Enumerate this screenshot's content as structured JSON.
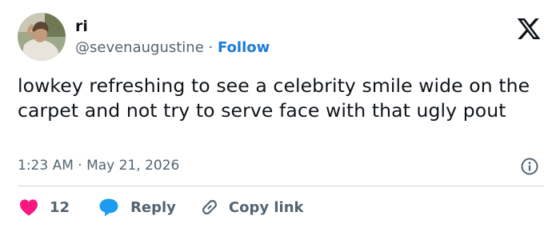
{
  "author": {
    "name": "ri",
    "handle": "@sevenaugustine",
    "separator": "·",
    "follow_label": "Follow"
  },
  "tweet": {
    "text": "lowkey refreshing to see a celebrity smile wide on the carpet and not try to serve face with that ugly pout",
    "timestamp": "1:23 AM · May 21, 2026"
  },
  "actions": {
    "like_count": "12",
    "reply_label": "Reply",
    "copy_link_label": "Copy link"
  },
  "icons": {
    "logo": "x-logo-icon",
    "info": "info-icon",
    "like": "heart-icon",
    "reply": "speech-bubble-icon",
    "copy": "link-icon"
  },
  "colors": {
    "link_blue": "#1d7bd8",
    "like_red": "#f91880",
    "reply_blue": "#1d9bf0",
    "secondary_text": "#536471"
  }
}
